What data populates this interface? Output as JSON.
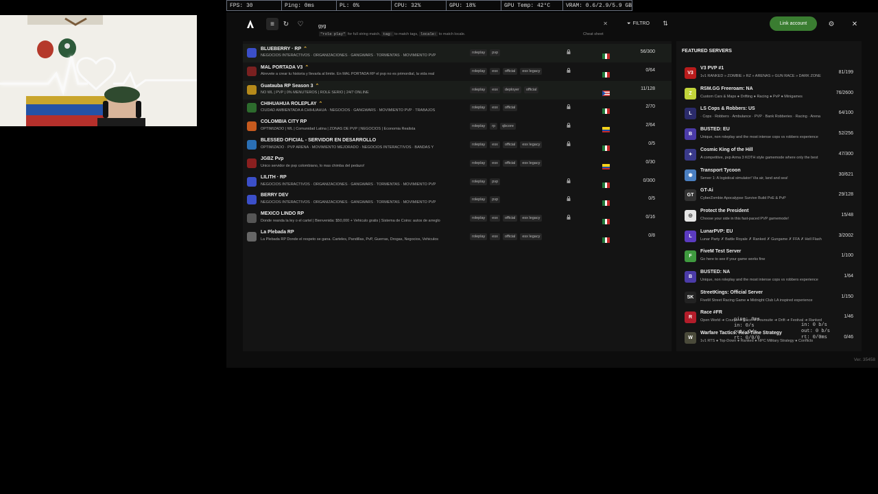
{
  "stats": [
    "FPS: 30",
    "Ping: 0ms",
    "PL: 0%",
    "CPU: 32%",
    "GPU: 18%",
    "GPU Temp: 42°C",
    "VRAM: 0.6/2.9/5.9 GB"
  ],
  "toolbar": {
    "search_value": "gyg",
    "hint_prefix": "",
    "hint_code1": "\"role play\"",
    "hint_text1": " for full string match, ",
    "hint_code2": "tag:",
    "hint_text2": " to match tags, ",
    "hint_code3": "locale:",
    "hint_text3": " to match locale.",
    "cheat_sheet": "Cheat sheet",
    "filter_label": "FILTRO",
    "link_account": "Link account"
  },
  "servers": [
    {
      "name": "BLUEBERRY · RP",
      "star": true,
      "desc": "NEGOCIOS INTERACTIVOS · ORGANIZACIONES · GANGWARS · TORMENTAS · MOVIMIENTO PVP",
      "tags": [
        "roleplay",
        "pvp"
      ],
      "lock": true,
      "flag": "mx",
      "players": "56/300",
      "icon_color": "#3b4fc9"
    },
    {
      "name": "MAL PORTADA V3",
      "star": true,
      "desc": "Atrevete a crear tu historia y llevarla al limite. En MAL PORTADA RP el pvp no es primordial, la vida real",
      "tags": [
        "roleplay",
        "esx",
        "official",
        "esx legacy"
      ],
      "lock": true,
      "flag": "mx",
      "players": "0/64",
      "icon_color": "#7a2020"
    },
    {
      "name": "Guatauba RP Season 3",
      "star": true,
      "desc": "NO WL | PVP | 0% MENUTEROS | ROLE SERIO | 24/7 ONLINE",
      "tags": [
        "roleplay",
        "esx",
        "deployer",
        "official"
      ],
      "lock": false,
      "flag": "pr",
      "players": "11/128",
      "icon_color": "#b58a1a"
    },
    {
      "name": "CHIHUAHUA ROLEPLAY",
      "star": true,
      "desc": "CIUDAD AMBIENTADA A CHIHUAHUA · NEGOCIOS · GANGWARS · MOVIMIENTO PVP · TRABAJOS",
      "tags": [
        "roleplay",
        "esx",
        "official"
      ],
      "lock": true,
      "flag": "mx",
      "players": "2/70",
      "icon_color": "#2d6b2d"
    },
    {
      "name": "COLOMBIA CITY RP",
      "star": false,
      "desc": "OPTIMIZADO | WL | Comunidad Latina | ZONAS DE PVP | NEGOCIOS | Economia Realista",
      "tags": [
        "roleplay",
        "rp",
        "qbcore"
      ],
      "lock": true,
      "flag": "co",
      "players": "2/64",
      "icon_color": "#c65a1e"
    },
    {
      "name": "BLESSED OFICIAL - SERVIDOR EN DESARROLLO",
      "star": false,
      "desc": "OPTIMIZADO · PVP ARENA · MOVIMIENTO MEJORADO · NEGOCIOS INTERACTIVOS · BANDAS Y",
      "tags": [
        "roleplay",
        "esx",
        "official",
        "esx legacy"
      ],
      "lock": true,
      "flag": "mx",
      "players": "0/5",
      "icon_color": "#2a6fb5"
    },
    {
      "name": "JGBZ Pvp",
      "star": false,
      "desc": "Unico servidor de pvp colombiano, lo mas chimba del pedazo!",
      "tags": [
        "roleplay",
        "esx",
        "official",
        "esx legacy"
      ],
      "lock": false,
      "flag": "co",
      "players": "0/30",
      "icon_color": "#8a1f1f"
    },
    {
      "name": "LILITH · RP",
      "star": false,
      "desc": "NEGOCIOS INTERACTIVOS · ORGANIZACIONES · GANGWARS · TORMENTAS · MOVIMIENTO PVP",
      "tags": [
        "roleplay",
        "pvp"
      ],
      "lock": true,
      "flag": "mx",
      "players": "0/300",
      "icon_color": "#3b4fc9"
    },
    {
      "name": "BERRY DEV",
      "star": false,
      "desc": "NEGOCIOS INTERACTIVOS · ORGANIZACIONES · GANGWARS · TORMENTAS · MOVIMIENTO PVP",
      "tags": [
        "roleplay",
        "pvp"
      ],
      "lock": true,
      "flag": "mx",
      "players": "0/5",
      "icon_color": "#3b4fc9"
    },
    {
      "name": "MEXICO LINDO RP",
      "star": false,
      "desc": "Donde reanda la ley o el cartel | Bienvenida: $50,000 + Vehiculo gratis | Sistema de Coins: autos de arreglo",
      "tags": [
        "roleplay",
        "esx",
        "official",
        "esx legacy"
      ],
      "lock": true,
      "flag": "mx",
      "players": "0/16",
      "icon_color": "#555555"
    },
    {
      "name": "La Plebada RP",
      "star": false,
      "desc": "La Plebada RP Donde el respeto se gana. Carteles, Pandillas, PvP, Guerras, Drogas, Negocios, Vehiculos",
      "tags": [
        "roleplay",
        "esx",
        "official",
        "esx legacy"
      ],
      "lock": false,
      "flag": "mx",
      "players": "0/8",
      "icon_color": "#666666"
    }
  ],
  "featured": {
    "title": "FEATURED SERVERS",
    "items": [
      {
        "name": "V3 PVP #1",
        "desc": "1v1 RANKED » ZOMBIE » RZ » ARENAS » GUN RACE » DARK ZONE",
        "players": "81/199",
        "icon_text": "V3",
        "icon_color": "#b91c1c"
      },
      {
        "name": "RSM.GG Freeroam: NA",
        "desc": "Custom Cars & Maps ● Drifting ● Racing ● PvP ● Minigames",
        "players": "76/2600",
        "icon_text": "Z",
        "icon_color": "#c2d43a"
      },
      {
        "name": "LS Cops & Robbers: US",
        "desc": "· Cops · Robbers · Ambulance · PVP · Bank Robberies · Racing · Arena",
        "players": "64/100",
        "icon_text": "L",
        "icon_color": "#2b2b6b"
      },
      {
        "name": "BUSTED: EU",
        "desc": "Unique, non roleplay and the most intense cops vs robbers experience",
        "players": "52/256",
        "icon_text": "B",
        "icon_color": "#4b3ba8"
      },
      {
        "name": "Cosmic King of the Hill",
        "desc": "A competitive, pvp Arma 3 KOTH style gamemode where only the best",
        "players": "47/300",
        "icon_text": "✦",
        "icon_color": "#3a3a8a"
      },
      {
        "name": "Transport Tycoon",
        "desc": "Server 1: A logistical simulator! Via air, land and sea!",
        "players": "30/621",
        "icon_text": "◉",
        "icon_color": "#4a7fc1"
      },
      {
        "name": "GT-Ai",
        "desc": "CyberZombie Apocalypse Survive Build PvE & PvP",
        "players": "29/128",
        "icon_text": "GT",
        "icon_color": "#333333"
      },
      {
        "name": "Protect the President",
        "desc": "Choose your side in this fast-paced PVP gamemode!",
        "players": "15/48",
        "icon_text": "◎",
        "icon_color": "#e5e5e5"
      },
      {
        "name": "LunarPVP: EU",
        "desc": "Lunar Party ✗ Battle Royale ✗ Ranked ✗ Gungame ✗ FFA ✗ Hell Flash",
        "players": "3/2002",
        "icon_text": "L",
        "icon_color": "#5b3bc0"
      },
      {
        "name": "FiveM Test Server",
        "desc": "Go here to see if your game works fine",
        "players": "1/100",
        "icon_text": "F",
        "icon_color": "#3f9a3f"
      },
      {
        "name": "BUSTED: NA",
        "desc": "Unique, non roleplay and the most intense cops vs robbers experience",
        "players": "1/64",
        "icon_text": "B",
        "icon_color": "#4b3ba8"
      },
      {
        "name": "StreetKings: Official Server",
        "desc": "FiveM Street Racing Game ● Midnight Club LA inspired experience",
        "players": "1/150",
        "icon_text": "SK",
        "icon_color": "#222222"
      },
      {
        "name": "Race #FR",
        "desc": "Open World ➜ Course ➜ Race ➜ Poursuite ➜ Drift ➜ Festival ➜ Ranked",
        "players": "1/46",
        "icon_text": "R",
        "icon_color": "#b31d2a"
      },
      {
        "name": "Warfare Tactics: Real-Time Strategy",
        "desc": "1v1 RTS ● Top-Down ● Ranked ● NPC Military Strategy ● Conflicts",
        "players": "0/46",
        "icon_text": "W",
        "icon_color": "#4a4a3a"
      }
    ]
  },
  "version": "Ver. 35458",
  "ping_overlay": "ping: 0ms\nin: 0/s\nout: 0/s\nrt: 0/0/0",
  "ping_overlay2": "in: 0 b/s\nout: 0 b/s\nrt: 0/0ms"
}
